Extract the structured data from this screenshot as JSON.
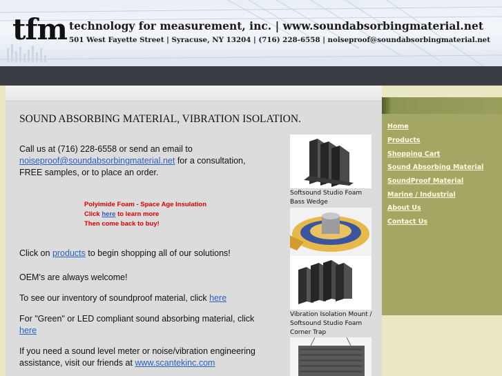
{
  "header": {
    "logo": "tfm",
    "tagline": "technology for measurement, inc.  |  www.soundabsorbingmaterial.net",
    "address": "501 West Fayette Street  |  Syracuse, NY 13204  |  (716) 228-6558  |  noiseproof@soundabsorbingmaterial.net"
  },
  "nav": {
    "items": [
      {
        "label": "Home"
      },
      {
        "label": "Products"
      },
      {
        "label": "Shopping Cart"
      },
      {
        "label": "Sound Absorbing Material"
      },
      {
        "label": "SoundProof Material"
      },
      {
        "label": "Marine / Industrial"
      },
      {
        "label": "About Us"
      },
      {
        "label": "Contact Us"
      }
    ]
  },
  "main": {
    "title": "SOUND ABSORBING MATERIAL, VIBRATION ISOLATION.",
    "call": {
      "before": "Call us at (716) 228-6558 or send an email to ",
      "email": "noiseproof@soundabsorbingmaterial.net",
      "after": " for a consultation, FREE samples, or to place an order."
    },
    "promo": {
      "line1": "Polyimide Foam - Space Age Insulation",
      "click": "Click ",
      "here": "here",
      "learn": " to learn more",
      "line3": "Then come back to buy!"
    },
    "products": {
      "before": "Click on ",
      "link": "products",
      "after": " to begin shopping all of our solutions!"
    },
    "oem": "OEM's are always welcome!",
    "inventory": {
      "before": "To see our inventory of soundproof material, click ",
      "link": "here"
    },
    "green": {
      "before": "For \"Green\" or LED compliant sound absorbing material, click ",
      "link": "here"
    },
    "meter": {
      "before": "If you need a sound level meter or noise/vibration engineering assistance, visit our friends at ",
      "link": "www.scantekinc.com"
    }
  },
  "gallery": {
    "caption1a": "Softsound Studio Foam",
    "caption1b": "Bass Wedge",
    "caption2a": "Vibration Isolation Mount /",
    "caption2b": "Softsound Studio Foam",
    "caption2c": "Corner Trap"
  }
}
